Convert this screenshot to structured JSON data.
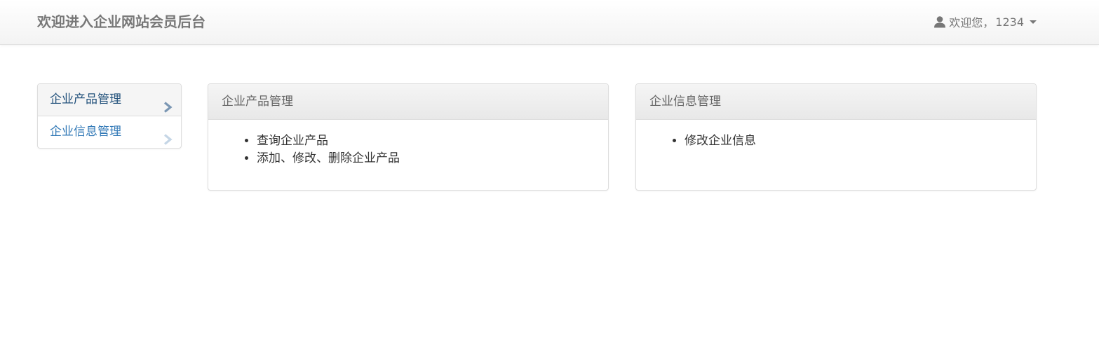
{
  "navbar": {
    "brand": "欢迎进入企业网站会员后台",
    "user": {
      "icon": "user-icon",
      "greeting": "欢迎您，",
      "username": "1234",
      "caret_icon": "caret-down-icon"
    }
  },
  "sidebar": {
    "items": [
      {
        "label": "企业产品管理",
        "active": true,
        "icon": "chevron-right-icon"
      },
      {
        "label": "企业信息管理",
        "active": false,
        "icon": "chevron-right-icon"
      }
    ]
  },
  "panels": [
    {
      "title": "企业产品管理",
      "items": [
        "查询企业产品",
        "添加、修改、删除企业产品"
      ]
    },
    {
      "title": "企业信息管理",
      "items": [
        "修改企业信息"
      ]
    }
  ],
  "colors": {
    "link": "#337ab7",
    "link_active": "#23527c",
    "muted_text": "#777777",
    "border": "#dddddd"
  }
}
